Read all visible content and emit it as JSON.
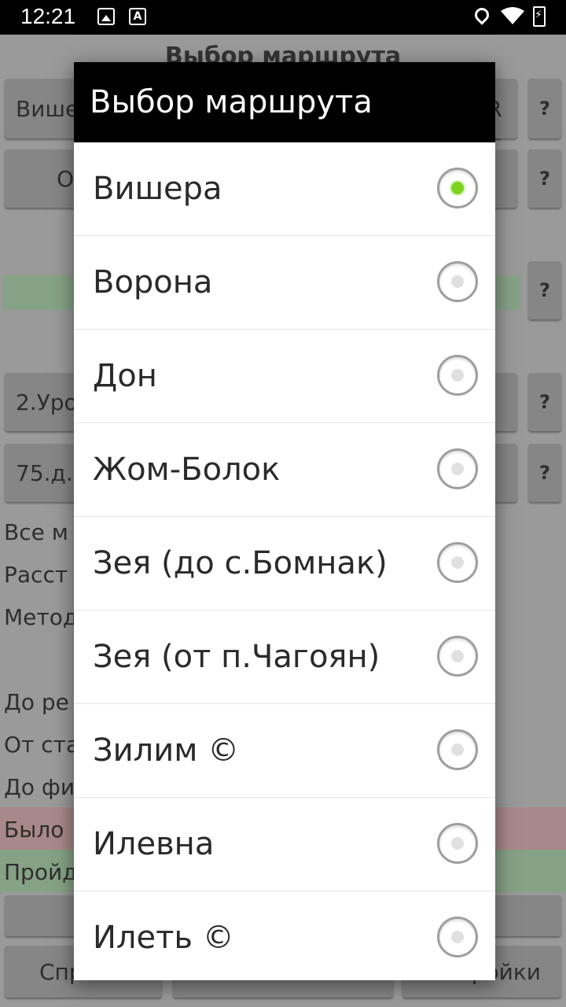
{
  "status_bar": {
    "time": "12:21",
    "icons": [
      "image-icon",
      "font-a-icon",
      "location-icon",
      "wifi-icon",
      "battery-charging-icon"
    ],
    "a_glyph": "A"
  },
  "background_app": {
    "title": "Выбор маршрута",
    "route_select": "Вишера",
    "r_button": "R",
    "help": "?",
    "open_button": "О",
    "level_select": "2.Уро",
    "distance_select": "75.д.",
    "lines": [
      "Все м",
      "Расст",
      "Метод",
      "До ре",
      "От ста",
      "До фи",
      "Было",
      "Пройд"
    ],
    "bottom_left": "Спр",
    "bottom_right": "ройки"
  },
  "dialog": {
    "title": "Выбор маршрута",
    "options": [
      {
        "label": "Вишера",
        "checked": true
      },
      {
        "label": "Ворона",
        "checked": false
      },
      {
        "label": "Дон",
        "checked": false
      },
      {
        "label": "Жом-Болок",
        "checked": false
      },
      {
        "label": "Зея (до с.Бомнак)",
        "checked": false
      },
      {
        "label": "Зея (от п.Чагоян)",
        "checked": false
      },
      {
        "label": "Зилим ©",
        "checked": false
      },
      {
        "label": "Илевна",
        "checked": false
      },
      {
        "label": "Илеть ©",
        "checked": false
      }
    ]
  },
  "colors": {
    "radio_checked": "#7ed321",
    "dialog_header": "#000000"
  }
}
